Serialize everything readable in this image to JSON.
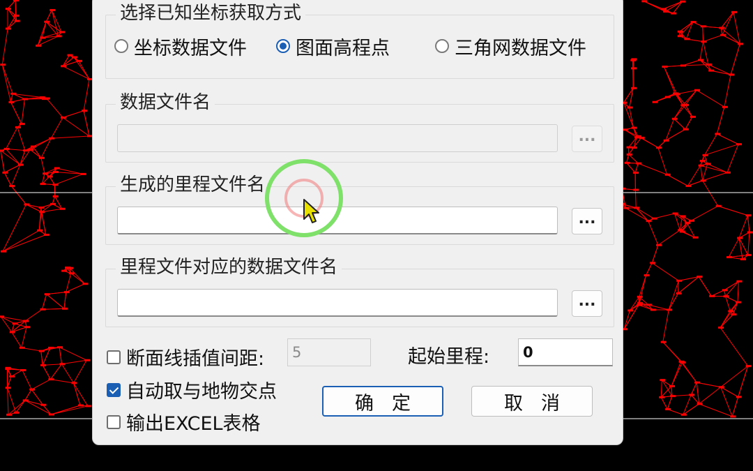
{
  "dialog": {
    "group1": {
      "title": "选择已知坐标获取方式",
      "options": [
        {
          "label": "坐标数据文件",
          "checked": false
        },
        {
          "label": "图面高程点",
          "checked": true
        },
        {
          "label": "三角网数据文件",
          "checked": false
        }
      ]
    },
    "group2": {
      "title": "数据文件名",
      "value": "",
      "browse_label": "...",
      "enabled": false
    },
    "group3": {
      "title": "生成的里程文件名",
      "value": "",
      "browse_label": "..."
    },
    "group4": {
      "title": "里程文件对应的数据文件名",
      "value": "",
      "browse_label": "..."
    },
    "interval": {
      "label": "断面线插值间距:",
      "value": "5",
      "checked": false
    },
    "start_mileage": {
      "label": "起始里程:",
      "value": "0"
    },
    "auto_intersect": {
      "label": "自动取与地物交点",
      "checked": true
    },
    "export_excel": {
      "label": "输出EXCEL表格",
      "checked": false
    },
    "ok_label": "确定",
    "cancel_label": "取消"
  },
  "colors": {
    "cad_lines": "#ff0000",
    "accent": "#1a5fb4",
    "cursor_ring": "#7fe06a",
    "cursor": "#f0e000"
  }
}
